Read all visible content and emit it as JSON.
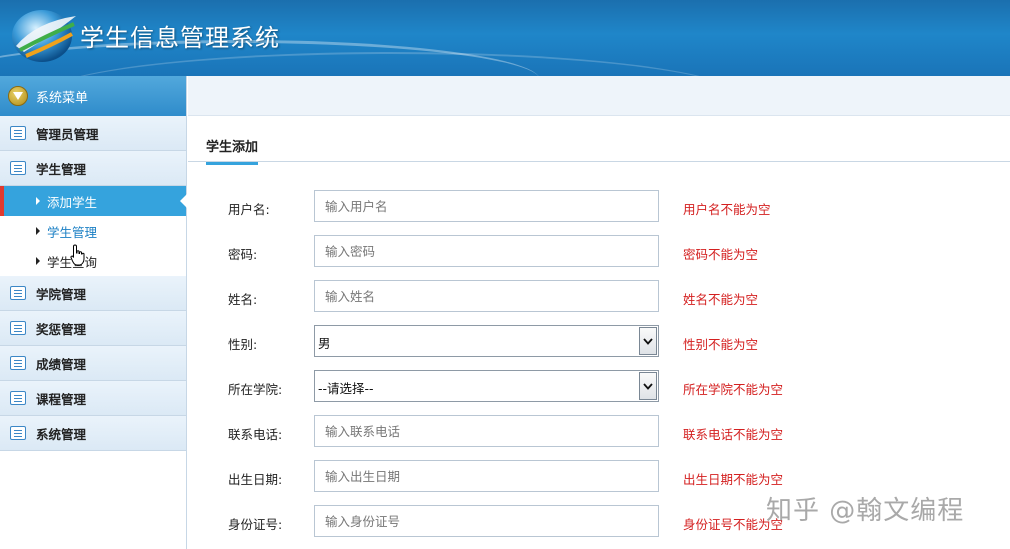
{
  "header": {
    "title": "学生信息管理系统",
    "icon": "globe-logo-icon"
  },
  "sidebar": {
    "menu_title": "系统菜单",
    "sections": [
      {
        "label": "管理员管理"
      },
      {
        "label": "学生管理"
      },
      {
        "label": "学院管理"
      },
      {
        "label": "奖惩管理"
      },
      {
        "label": "成绩管理"
      },
      {
        "label": "课程管理"
      },
      {
        "label": "系统管理"
      }
    ],
    "student_sub": [
      {
        "label": "添加学生"
      },
      {
        "label": "学生管理"
      },
      {
        "label": "学生查询"
      }
    ]
  },
  "main": {
    "tab": "学生添加",
    "fields": [
      {
        "label": "用户名:",
        "placeholder": "输入用户名",
        "error": "用户名不能为空"
      },
      {
        "label": "密码:",
        "placeholder": "输入密码",
        "error": "密码不能为空"
      },
      {
        "label": "姓名:",
        "placeholder": "输入姓名",
        "error": "姓名不能为空"
      },
      {
        "label": "性别:",
        "value": "男",
        "error": "性别不能为空"
      },
      {
        "label": "所在学院:",
        "value": "--请选择--",
        "error": "所在学院不能为空"
      },
      {
        "label": "联系电话:",
        "placeholder": "输入联系电话",
        "error": "联系电话不能为空"
      },
      {
        "label": "出生日期:",
        "placeholder": "输入出生日期",
        "error": "出生日期不能为空"
      },
      {
        "label": "身份证号:",
        "placeholder": "输入身份证号",
        "error": "身份证号不能为空"
      }
    ]
  },
  "watermark": "知乎 @翰文编程",
  "colors": {
    "header": "#1f86c9",
    "active_item": "#35a3dd",
    "error": "#d42020",
    "active_marker": "#e03a2f"
  }
}
